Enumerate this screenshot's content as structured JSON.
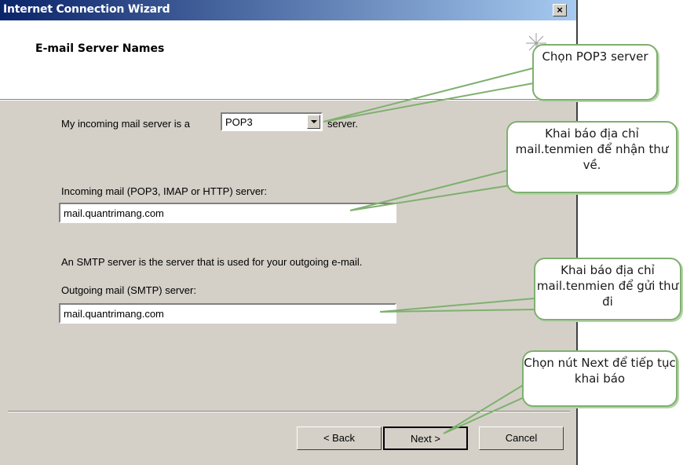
{
  "window": {
    "title": "Internet Connection Wizard",
    "close_glyph": "×",
    "header_title": "E-mail Server Names"
  },
  "form": {
    "incoming_type_prefix": "My incoming mail server is a",
    "incoming_type_value": "POP3",
    "incoming_type_suffix": "server.",
    "incoming_label": "Incoming mail (POP3, IMAP or HTTP) server:",
    "incoming_value": "mail.quantrimang.com",
    "smtp_info": "An SMTP server is the server that is used for your outgoing e-mail.",
    "outgoing_label": "Outgoing mail (SMTP) server:",
    "outgoing_value": "mail.quantrimang.com"
  },
  "buttons": {
    "back": "< Back",
    "next": "Next >",
    "cancel": "Cancel"
  },
  "callouts": {
    "pop3": "Chọn POP3 server",
    "incoming": "Khai báo địa chỉ mail.tenmien để nhận thư về.",
    "outgoing": "Khai báo địa chỉ mail.tenmien để gửi thư đi",
    "next": "Chọn nút Next để tiếp tục khai báo"
  },
  "colors": {
    "titlebar_start": "#0a246a",
    "titlebar_end": "#a6caf0",
    "dialog_bg": "#d4d0c8",
    "callout_border": "#7fb06f"
  }
}
